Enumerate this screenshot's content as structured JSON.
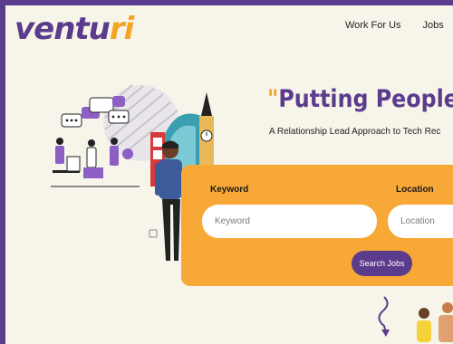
{
  "header": {
    "logo": {
      "text_main": "ventu",
      "text_accent": "ri",
      "colors": {
        "main": "#5b3b8c",
        "accent": "#f5a524"
      }
    },
    "nav": [
      {
        "label": "Work For Us"
      },
      {
        "label": "Jobs"
      }
    ]
  },
  "hero": {
    "headline_quote": "\"",
    "headline": "Putting People Fi",
    "subheadline": "A Relationship Lead Approach to Tech Rec"
  },
  "search": {
    "keyword_label": "Keyword",
    "keyword_placeholder": "Keyword",
    "location_label": "Location",
    "location_placeholder": "Location",
    "button_label": "Search Jobs"
  },
  "theme": {
    "frame": "#5b3b8c",
    "background": "#f7f5ea",
    "panel": "#f7a836",
    "button": "#5b3b8c"
  }
}
